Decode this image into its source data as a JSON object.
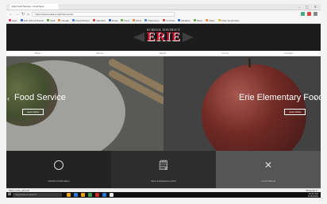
{
  "browser": {
    "tab_title": "Erie Food Service - Food Serv",
    "window_controls": "– ◻ ✕",
    "url": "https://www.eriek12.org/food-service",
    "bookmarks": [
      "Apps",
      "Erie School District",
      "Staff",
      "Google",
      "PowerSchool",
      "Calendar",
      "Email",
      "Docs",
      "Drive",
      "Classroom",
      "YouTube",
      "Weather",
      "News",
      "Maps",
      "Other bookmarks"
    ],
    "nav_icons": {
      "back": "←",
      "forward": "→",
      "reload": "↻",
      "home": "⌂"
    },
    "extension_colors": [
      "#4a8",
      "#d44",
      "#888"
    ]
  },
  "site": {
    "logo_sub": "SCHOOL DISTRICT",
    "logo_main": "ERIE",
    "nav": [
      "About",
      "Menus",
      "Meals",
      "Forms",
      "Contact"
    ]
  },
  "hero": {
    "left": {
      "title": "Food Service",
      "button": "Learn More",
      "prev_icon": "‹"
    },
    "right": {
      "title": "Erie Elementary Food",
      "button": "Learn More",
      "next_icon": "›"
    }
  },
  "tiles": [
    {
      "icon": "circle-icon",
      "glyph": "",
      "label": "Nutrition Information"
    },
    {
      "icon": "document-icon",
      "glyph": "🗒",
      "label": "Free & Reduced Lunch"
    },
    {
      "icon": "utensils-icon",
      "glyph": "✕",
      "label": "Lunch Menus"
    }
  ],
  "downloads": {
    "item": "food_menu_jan.pdf",
    "show_all": "Show all ✕"
  },
  "taskbar": {
    "start_icon": "⊞",
    "search_placeholder": "Type here to search",
    "app_colors": [
      "#e8a317",
      "#2a78d6",
      "#e8a317",
      "#3b9d4a",
      "#cc2c2c",
      "#2a78d6",
      "#eee"
    ],
    "time": "10:42 AM",
    "date": "1/15/2019"
  }
}
